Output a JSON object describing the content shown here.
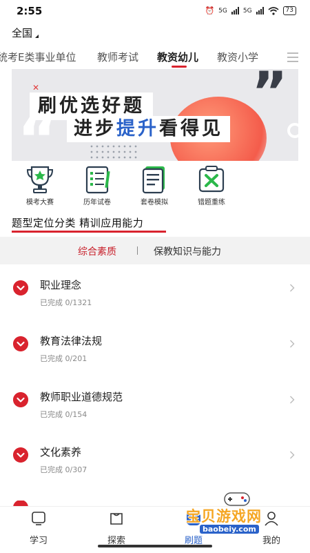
{
  "status": {
    "time": "2:55",
    "net1": "5G",
    "net2": "5G",
    "battery": "73"
  },
  "header": {
    "region": "全国"
  },
  "tabs": [
    {
      "label": "统考E类事业单位"
    },
    {
      "label": "教师考试"
    },
    {
      "label": "教资幼儿",
      "active": true
    },
    {
      "label": "教资小学"
    }
  ],
  "banner": {
    "line1": "刷优选好题",
    "line2_a": "进步",
    "line2_b": "提升",
    "line2_c": "看得见"
  },
  "quick_actions": [
    {
      "label": "模考大赛",
      "icon": "trophy-icon"
    },
    {
      "label": "历年试卷",
      "icon": "paper-list-icon"
    },
    {
      "label": "套卷模拟",
      "icon": "document-icon"
    },
    {
      "label": "错题重练",
      "icon": "wrong-mark-icon"
    }
  ],
  "section": {
    "title": "题型定位分类 精训应用能力"
  },
  "subtabs": {
    "active": "综合素质",
    "other": "保教知识与能力",
    "separator": "|"
  },
  "list": [
    {
      "title": "职业理念",
      "progress": "已完成 0/1321"
    },
    {
      "title": "教育法律法规",
      "progress": "已完成 0/201"
    },
    {
      "title": "教师职业道德规范",
      "progress": "已完成 0/154"
    },
    {
      "title": "文化素养",
      "progress": "已完成 0/307"
    }
  ],
  "bottom_nav": [
    {
      "label": "学习",
      "icon": "study-icon"
    },
    {
      "label": "探索",
      "icon": "explore-icon"
    },
    {
      "label": "刷题",
      "icon": "practice-icon",
      "active": true
    },
    {
      "label": "我的",
      "icon": "profile-icon"
    }
  ],
  "watermark": {
    "text": "宝贝游戏网",
    "url": "baobeiy.com"
  },
  "colors": {
    "accent_red": "#d9232e",
    "brand_blue": "#2a62c9",
    "icon_green": "#2bb84a",
    "icon_navy": "#2c3e50"
  }
}
